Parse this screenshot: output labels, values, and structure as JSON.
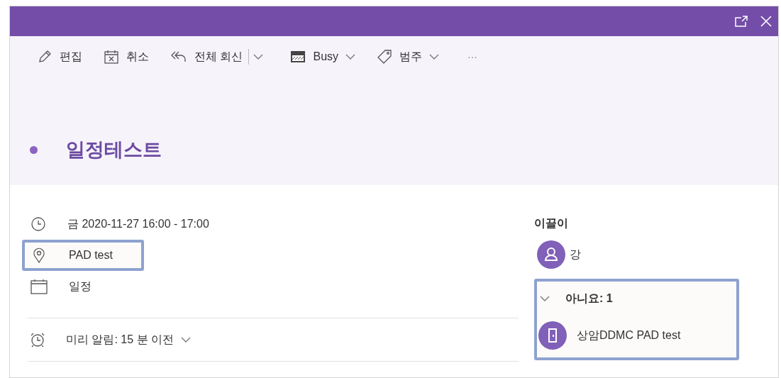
{
  "toolbar": [
    {
      "kind": "edit",
      "label": "편집"
    },
    {
      "kind": "cancel",
      "label": "취소"
    },
    {
      "kind": "reply_all",
      "label": "전체 회신",
      "split": true
    },
    {
      "kind": "busy",
      "label": "Busy",
      "dropdown": true
    },
    {
      "kind": "category",
      "label": "범주",
      "dropdown": true
    },
    {
      "kind": "more",
      "label": "···"
    }
  ],
  "event": {
    "title": "일정테스트",
    "color": "#8a63c2"
  },
  "details": [
    {
      "kind": "time",
      "text": "금 2020-11-27 16:00 - 17:00",
      "highlighted": false
    },
    {
      "kind": "location",
      "text": "PAD test",
      "highlighted": true
    },
    {
      "kind": "calendar",
      "text": "일정",
      "highlighted": false
    }
  ],
  "reminder": {
    "text": "미리 알림: 15 분 이전"
  },
  "attendees": {
    "heading": "이끌이",
    "organizer": {
      "name": "강",
      "kind": "person"
    },
    "group": {
      "label": "아니요: 1",
      "expanded": true,
      "highlighted": true,
      "members": [
        {
          "name": "상암DDMC PAD test",
          "kind": "room"
        }
      ]
    }
  }
}
